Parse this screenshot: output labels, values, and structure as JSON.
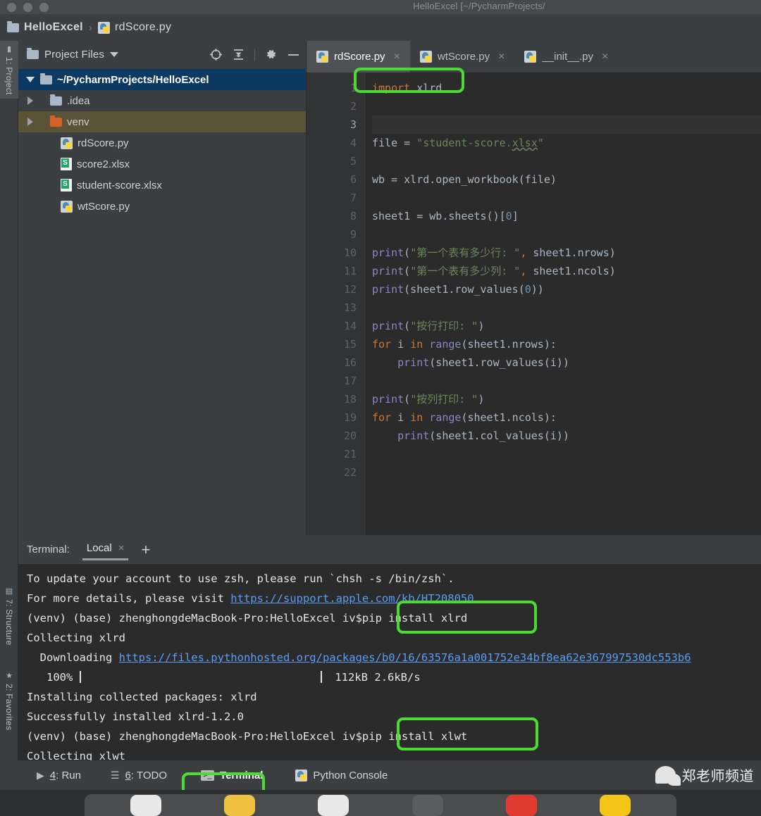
{
  "window": {
    "title": "HelloExcel [~/PycharmProjects/",
    "traffic_lights": [
      "close",
      "minimize",
      "zoom"
    ]
  },
  "breadcrumb": {
    "items": [
      {
        "label": "HelloExcel",
        "icon": "folder-icon"
      },
      {
        "label": "rdScore.py",
        "icon": "python-file-icon"
      }
    ],
    "separator": "›"
  },
  "left_toolstrip": {
    "tabs": [
      {
        "label": "1: Project",
        "icon": "folder-icon",
        "active": true
      },
      {
        "label": "7: Structure",
        "icon": "structure-icon",
        "active": false
      },
      {
        "label": "2: Favorites",
        "icon": "star-icon",
        "active": false
      }
    ]
  },
  "project_panel": {
    "title": "Project Files",
    "dropdown_icon": "chevron-down-icon",
    "actions": [
      {
        "name": "locate-icon",
        "title": "Select Opened File"
      },
      {
        "name": "collapse-all-icon",
        "title": "Collapse All"
      },
      {
        "name": "gear-icon",
        "title": "Settings"
      },
      {
        "name": "minimize-icon",
        "title": "Hide"
      }
    ],
    "tree": [
      {
        "label": "~/PycharmProjects/HelloExcel",
        "icon": "folder-icon",
        "twisty": "expanded",
        "indent": 0,
        "state": "selected"
      },
      {
        "label": ".idea",
        "icon": "folder-icon",
        "twisty": "collapsed",
        "indent": 1,
        "state": "normal"
      },
      {
        "label": "venv",
        "icon": "folder-icon-orange",
        "twisty": "collapsed",
        "indent": 1,
        "state": "hover"
      },
      {
        "label": "rdScore.py",
        "icon": "python-file-icon",
        "twisty": "none",
        "indent": 2,
        "state": "normal"
      },
      {
        "label": "score2.xlsx",
        "icon": "excel-file-icon",
        "twisty": "none",
        "indent": 2,
        "state": "normal"
      },
      {
        "label": "student-score.xlsx",
        "icon": "excel-file-icon",
        "twisty": "none",
        "indent": 2,
        "state": "normal"
      },
      {
        "label": "wtScore.py",
        "icon": "python-file-icon",
        "twisty": "none",
        "indent": 2,
        "state": "normal"
      }
    ]
  },
  "editor": {
    "tabs": [
      {
        "label": "rdScore.py",
        "icon": "python-file-icon",
        "close": "×",
        "active": true
      },
      {
        "label": "wtScore.py",
        "icon": "python-file-icon",
        "close": "×",
        "active": false
      },
      {
        "label": "__init__.py",
        "icon": "python-file-icon",
        "close": "×",
        "active": false
      }
    ],
    "line_numbers": [
      "1",
      "2",
      "3",
      "4",
      "5",
      "6",
      "7",
      "8",
      "9",
      "10",
      "11",
      "12",
      "13",
      "14",
      "15",
      "16",
      "17",
      "18",
      "19",
      "20",
      "21",
      "22"
    ],
    "current_line": 3,
    "code": [
      {
        "n": 1,
        "text": "import xlrd"
      },
      {
        "n": 2,
        "text": ""
      },
      {
        "n": 3,
        "text": ""
      },
      {
        "n": 4,
        "text": "file = \"student-score.xlsx\""
      },
      {
        "n": 5,
        "text": ""
      },
      {
        "n": 6,
        "text": "wb = xlrd.open_workbook(file)"
      },
      {
        "n": 7,
        "text": ""
      },
      {
        "n": 8,
        "text": "sheet1 = wb.sheets()[0]"
      },
      {
        "n": 9,
        "text": ""
      },
      {
        "n": 10,
        "text": "print(\"第一个表有多少行: \", sheet1.nrows)"
      },
      {
        "n": 11,
        "text": "print(\"第一个表有多少列: \", sheet1.ncols)"
      },
      {
        "n": 12,
        "text": "print(sheet1.row_values(0))"
      },
      {
        "n": 13,
        "text": ""
      },
      {
        "n": 14,
        "text": "print(\"按行打印: \")"
      },
      {
        "n": 15,
        "text": "for i in range(sheet1.nrows):"
      },
      {
        "n": 16,
        "text": "    print(sheet1.row_values(i))"
      },
      {
        "n": 17,
        "text": ""
      },
      {
        "n": 18,
        "text": "print(\"按列打印: \")"
      },
      {
        "n": 19,
        "text": "for i in range(sheet1.ncols):"
      },
      {
        "n": 20,
        "text": "    print(sheet1.col_values(i))"
      },
      {
        "n": 21,
        "text": ""
      },
      {
        "n": 22,
        "text": ""
      }
    ]
  },
  "terminal": {
    "label": "Terminal:",
    "tab": "Local",
    "tab_close": "×",
    "add": "+",
    "prompt": "(venv) (base) zhenghongdeMacBook-Pro:HelloExcel iv$",
    "lines": [
      "To update your account to use zsh, please run `chsh -s /bin/zsh`.",
      "For more details, please visit https://support.apple.com/kb/HT208050",
      "(venv) (base) zhenghongdeMacBook-Pro:HelloExcel iv$ pip install xlrd",
      "Collecting xlrd",
      "  Downloading https://files.pythonhosted.org/packages/b0/16/63576a1a001752e34bf8ea62e367997530dc553b6",
      "   100% |                        | 112kB 2.6kB/s",
      "Installing collected packages: xlrd",
      "Successfully installed xlrd-1.2.0",
      "(venv) (base) zhenghongdeMacBook-Pro:HelloExcel iv$ pip install xlwt",
      "Collecting xlwt"
    ],
    "link1": "https://support.apple.com/kb/HT208050",
    "link2": "https://files.pythonhosted.org/packages/b0/16/63576a1a001752e34bf8ea62e367997530dc553b6",
    "command1": "pip install xlrd",
    "command2": "pip install xlwt",
    "progress_percent": "100%",
    "progress_size": "112kB",
    "progress_speed": "2.6kB/s",
    "text_before_cmd1": "To update your account to use zsh, please run `chsh -s /bin/zsh`.",
    "text_before_link2": "For more details, please visit ",
    "downloading_label": "  Downloading ",
    "collecting_xlrd": "Collecting xlrd",
    "installing": "Installing collected packages: xlrd",
    "success": "Successfully installed xlrd-1.2.0",
    "collecting_xlwt": "Collecting xlwt"
  },
  "statusbar": {
    "buttons": [
      {
        "num": "4",
        "label": ": Run",
        "icon": "play-icon",
        "active": false
      },
      {
        "num": "6",
        "label": ": TODO",
        "icon": "list-icon",
        "active": false
      },
      {
        "num": "",
        "label": "Terminal",
        "icon": "terminal-icon",
        "active": true
      },
      {
        "num": "",
        "label": "Python Console",
        "icon": "python-icon",
        "active": false
      }
    ]
  },
  "watermark": {
    "text": "郑老师频道",
    "icon": "wechat-icon"
  },
  "annotations": {
    "accent": "#4cdb32",
    "boxes": [
      {
        "target": "import-xlrd-line"
      },
      {
        "target": "pip-install-xlrd-command"
      },
      {
        "target": "pip-install-xlwt-command"
      },
      {
        "target": "terminal-statusbar-button"
      }
    ]
  }
}
